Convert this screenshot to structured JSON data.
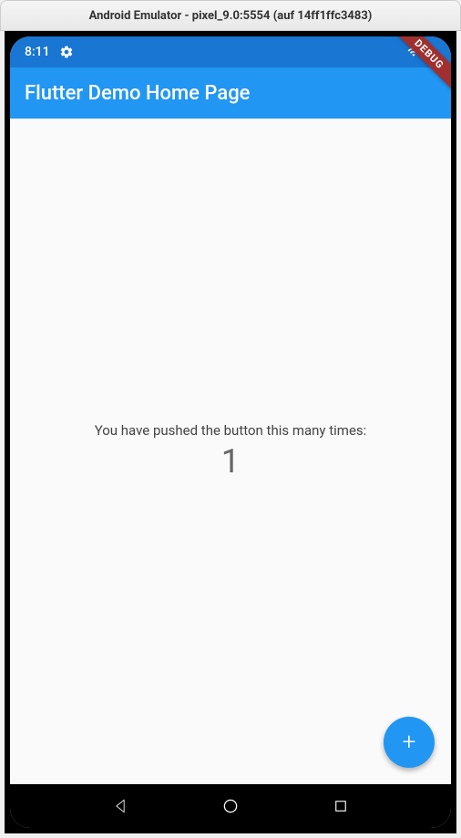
{
  "window": {
    "title": "Android Emulator - pixel_9.0:5554 (auf 14ff1ffc3483)"
  },
  "statusBar": {
    "time": "8:11"
  },
  "appBar": {
    "title": "Flutter Demo Home Page"
  },
  "content": {
    "message": "You have pushed the button this many times:",
    "count": "1"
  },
  "fab": {
    "label": "+"
  },
  "debugBanner": {
    "text": "DEBUG"
  }
}
